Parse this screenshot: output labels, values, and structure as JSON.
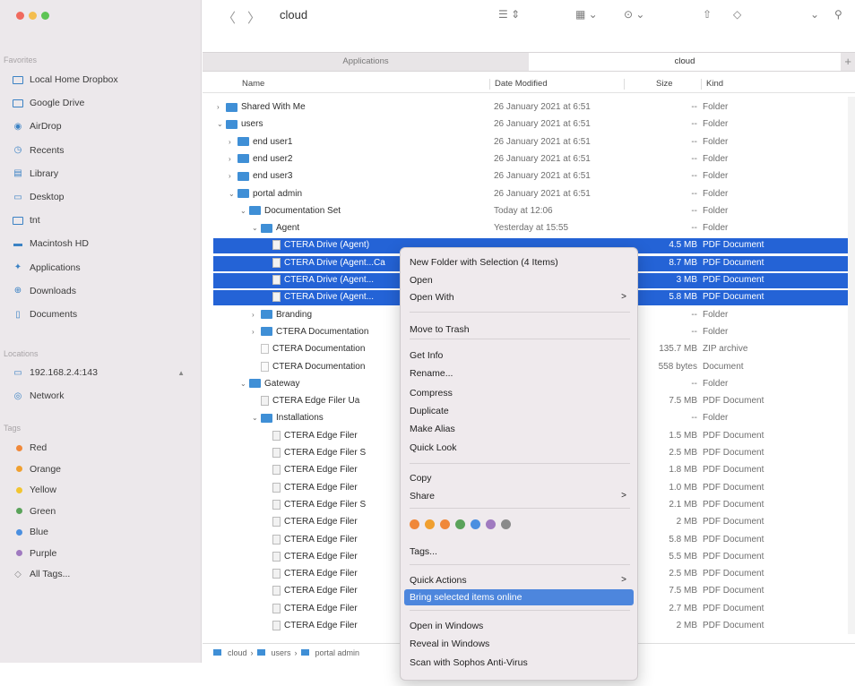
{
  "toolbar": {
    "back": "〈",
    "forward": "〉",
    "title": "cloud",
    "icons": [
      "list-view-icon",
      "group-icon",
      "action-icon",
      "share-icon",
      "tag-icon",
      "chevron-down-icon",
      "search-icon"
    ]
  },
  "tabs": [
    {
      "label": "Applications",
      "active": false
    },
    {
      "label": "cloud",
      "active": true
    }
  ],
  "tab_add": "+",
  "columns": {
    "name": "Name",
    "date": "Date Modified",
    "size": "Size",
    "kind": "Kind"
  },
  "sidebar": {
    "favorites_header": "Favorites",
    "favorites": [
      {
        "label": "Local Home Dropbox",
        "icon": "folder-icon"
      },
      {
        "label": "Google Drive",
        "icon": "folder-icon"
      },
      {
        "label": "AirDrop",
        "icon": "airdrop-icon"
      },
      {
        "label": "Recents",
        "icon": "clock-icon"
      },
      {
        "label": "Library",
        "icon": "library-icon"
      },
      {
        "label": "Desktop",
        "icon": "desktop-icon"
      },
      {
        "label": "tnt",
        "icon": "folder-icon"
      },
      {
        "label": "Macintosh HD",
        "icon": "disk-icon"
      },
      {
        "label": "Applications",
        "icon": "apps-icon"
      },
      {
        "label": "Downloads",
        "icon": "download-icon"
      },
      {
        "label": "Documents",
        "icon": "document-icon"
      }
    ],
    "locations_header": "Locations",
    "locations": [
      {
        "label": "192.168.2.4:143",
        "icon": "display-icon",
        "eject": "▲"
      },
      {
        "label": "Network",
        "icon": "network-icon"
      }
    ],
    "tags_header": "Tags",
    "tags": [
      {
        "label": "Red",
        "color": "#f0883a"
      },
      {
        "label": "Orange",
        "color": "#f0a030"
      },
      {
        "label": "Yellow",
        "color": "#f2c530"
      },
      {
        "label": "Green",
        "color": "#5aa35a"
      },
      {
        "label": "Blue",
        "color": "#4a8fe0"
      },
      {
        "label": "Purple",
        "color": "#a07ac0"
      },
      {
        "label": "All Tags...",
        "color": ""
      }
    ]
  },
  "rows": [
    {
      "name": "Shared With Me",
      "indent": 0,
      "disc": ">",
      "icon": "folder",
      "date": "26 January 2021 at 6:51",
      "size": "--",
      "kind": "Folder",
      "sel": false
    },
    {
      "name": "users",
      "indent": 0,
      "disc": "v",
      "icon": "folder",
      "date": "26 January 2021 at 6:51",
      "size": "--",
      "kind": "Folder",
      "sel": false
    },
    {
      "name": "end user1",
      "indent": 1,
      "disc": ">",
      "icon": "folder",
      "date": "26 January 2021 at 6:51",
      "size": "--",
      "kind": "Folder",
      "sel": false
    },
    {
      "name": "end user2",
      "indent": 1,
      "disc": ">",
      "icon": "folder",
      "date": "26 January 2021 at 6:51",
      "size": "--",
      "kind": "Folder",
      "sel": false
    },
    {
      "name": "end user3",
      "indent": 1,
      "disc": ">",
      "icon": "folder",
      "date": "26 January 2021 at 6:51",
      "size": "--",
      "kind": "Folder",
      "sel": false
    },
    {
      "name": "portal admin",
      "indent": 1,
      "disc": "v",
      "icon": "folder",
      "date": "26 January 2021 at 6:51",
      "size": "--",
      "kind": "Folder",
      "sel": false
    },
    {
      "name": "Documentation Set",
      "indent": 2,
      "disc": "v",
      "icon": "folder",
      "date": "Today at 12:06",
      "size": "--",
      "kind": "Folder",
      "sel": false
    },
    {
      "name": "Agent",
      "indent": 3,
      "disc": "v",
      "icon": "folder",
      "date": "Yesterday at 15:55",
      "size": "--",
      "kind": "Folder",
      "sel": false
    },
    {
      "name": "CTERA Drive (Agent)",
      "indent": 4,
      "disc": "",
      "icon": "pdf",
      "date": "",
      "size": "4.5 MB",
      "kind": "PDF Document",
      "sel": true
    },
    {
      "name": "CTERA Drive (Agent...Ca",
      "indent": 4,
      "disc": "",
      "icon": "pdf",
      "date": "",
      "size": "8.7 MB",
      "kind": "PDF Document",
      "sel": true
    },
    {
      "name": "CTERA Drive (Agent...",
      "indent": 4,
      "disc": "",
      "icon": "pdf",
      "date": "",
      "size": "3 MB",
      "kind": "PDF Document",
      "sel": true
    },
    {
      "name": "CTERA Drive (Agent...",
      "indent": 4,
      "disc": "",
      "icon": "pdf",
      "date": "",
      "size": "5.8 MB",
      "kind": "PDF Document",
      "sel": true
    },
    {
      "name": "Branding",
      "indent": 3,
      "disc": ">",
      "icon": "folder",
      "date": "",
      "size": "--",
      "kind": "Folder",
      "sel": false
    },
    {
      "name": "CTERA Documentation",
      "indent": 3,
      "disc": ">",
      "icon": "folder",
      "date": "",
      "size": "--",
      "kind": "Folder",
      "sel": false
    },
    {
      "name": "CTERA Documentation",
      "indent": 3,
      "disc": "",
      "icon": "doc",
      "date": "",
      "size": "135.7 MB",
      "kind": "ZIP archive",
      "sel": false
    },
    {
      "name": "CTERA Documentation",
      "indent": 3,
      "disc": "",
      "icon": "doc",
      "date": "",
      "size": "558 bytes",
      "kind": "Document",
      "sel": false
    },
    {
      "name": "Gateway",
      "indent": 2,
      "disc": "v",
      "icon": "folder",
      "date": "",
      "size": "--",
      "kind": "Folder",
      "sel": false
    },
    {
      "name": "CTERA Edge Filer Ua",
      "indent": 3,
      "disc": "",
      "icon": "pdf",
      "date": "",
      "size": "7.5 MB",
      "kind": "PDF Document",
      "sel": false
    },
    {
      "name": "Installations",
      "indent": 3,
      "disc": "v",
      "icon": "folder",
      "date": "",
      "size": "--",
      "kind": "Folder",
      "sel": false
    },
    {
      "name": "CTERA Edge Filer",
      "indent": 4,
      "disc": "",
      "icon": "pdf",
      "date": "",
      "size": "1.5 MB",
      "kind": "PDF Document",
      "sel": false
    },
    {
      "name": "CTERA Edge Filer S",
      "indent": 4,
      "disc": "",
      "icon": "pdf",
      "date": "",
      "size": "2.5 MB",
      "kind": "PDF Document",
      "sel": false
    },
    {
      "name": "CTERA Edge Filer",
      "indent": 4,
      "disc": "",
      "icon": "pdf",
      "date": "",
      "size": "1.8 MB",
      "kind": "PDF Document",
      "sel": false
    },
    {
      "name": "CTERA Edge Filer",
      "indent": 4,
      "disc": "",
      "icon": "pdf",
      "date": "",
      "size": "1.0 MB",
      "kind": "PDF Document",
      "sel": false
    },
    {
      "name": "CTERA Edge Filer S",
      "indent": 4,
      "disc": "",
      "icon": "pdf",
      "date": "",
      "size": "2.1 MB",
      "kind": "PDF Document",
      "sel": false
    },
    {
      "name": "CTERA Edge Filer",
      "indent": 4,
      "disc": "",
      "icon": "pdf",
      "date": "",
      "size": "2 MB",
      "kind": "PDF Document",
      "sel": false
    },
    {
      "name": "CTERA Edge Filer",
      "indent": 4,
      "disc": "",
      "icon": "pdf",
      "date": "",
      "size": "5.8 MB",
      "kind": "PDF Document",
      "sel": false
    },
    {
      "name": "CTERA Edge Filer",
      "indent": 4,
      "disc": "",
      "icon": "pdf",
      "date": "",
      "size": "5.5 MB",
      "kind": "PDF Document",
      "sel": false
    },
    {
      "name": "CTERA Edge Filer",
      "indent": 4,
      "disc": "",
      "icon": "pdf",
      "date": "",
      "size": "2.5 MB",
      "kind": "PDF Document",
      "sel": false
    },
    {
      "name": "CTERA Edge Filer",
      "indent": 4,
      "disc": "",
      "icon": "pdf",
      "date": "",
      "size": "7.5 MB",
      "kind": "PDF Document",
      "sel": false
    },
    {
      "name": "CTERA Edge Filer",
      "indent": 4,
      "disc": "",
      "icon": "pdf",
      "date": "",
      "size": "2.7 MB",
      "kind": "PDF Document",
      "sel": false
    },
    {
      "name": "CTERA Edge Filer",
      "indent": 4,
      "disc": "",
      "icon": "pdf",
      "date": "",
      "size": "2 MB",
      "kind": "PDF Document",
      "sel": false
    }
  ],
  "pathbar": [
    "cloud",
    "users",
    "portal admin"
  ],
  "context_menu": {
    "items": [
      {
        "label": "New Folder with Selection (4 Items)",
        "arrow": ""
      },
      {
        "label": "Open",
        "arrow": ""
      },
      {
        "label": "Open With",
        "arrow": ">"
      },
      {
        "label": "Move to Trash",
        "arrow": ""
      },
      {
        "label": "Get Info",
        "arrow": ""
      },
      {
        "label": "Rename...",
        "arrow": ""
      },
      {
        "label": "Compress",
        "arrow": ""
      },
      {
        "label": "Duplicate",
        "arrow": ""
      },
      {
        "label": "Make Alias",
        "arrow": ""
      },
      {
        "label": "Quick Look",
        "arrow": ""
      },
      {
        "label": "Copy",
        "arrow": ""
      },
      {
        "label": "Share",
        "arrow": ">"
      },
      {
        "label": "Tags...",
        "arrow": ""
      },
      {
        "label": "Quick Actions",
        "arrow": ">"
      },
      {
        "label": "Bring selected items online",
        "arrow": "",
        "highlighted": true
      },
      {
        "label": "Open in Windows",
        "arrow": ""
      },
      {
        "label": "Reveal in Windows",
        "arrow": ""
      },
      {
        "label": "Scan with Sophos Anti-Virus",
        "arrow": ""
      }
    ],
    "tag_colors": [
      "#f0883a",
      "#f0a030",
      "#f0883a",
      "#5aa35a",
      "#4a8fe0",
      "#a07ac0",
      "#8a8a8a"
    ]
  }
}
